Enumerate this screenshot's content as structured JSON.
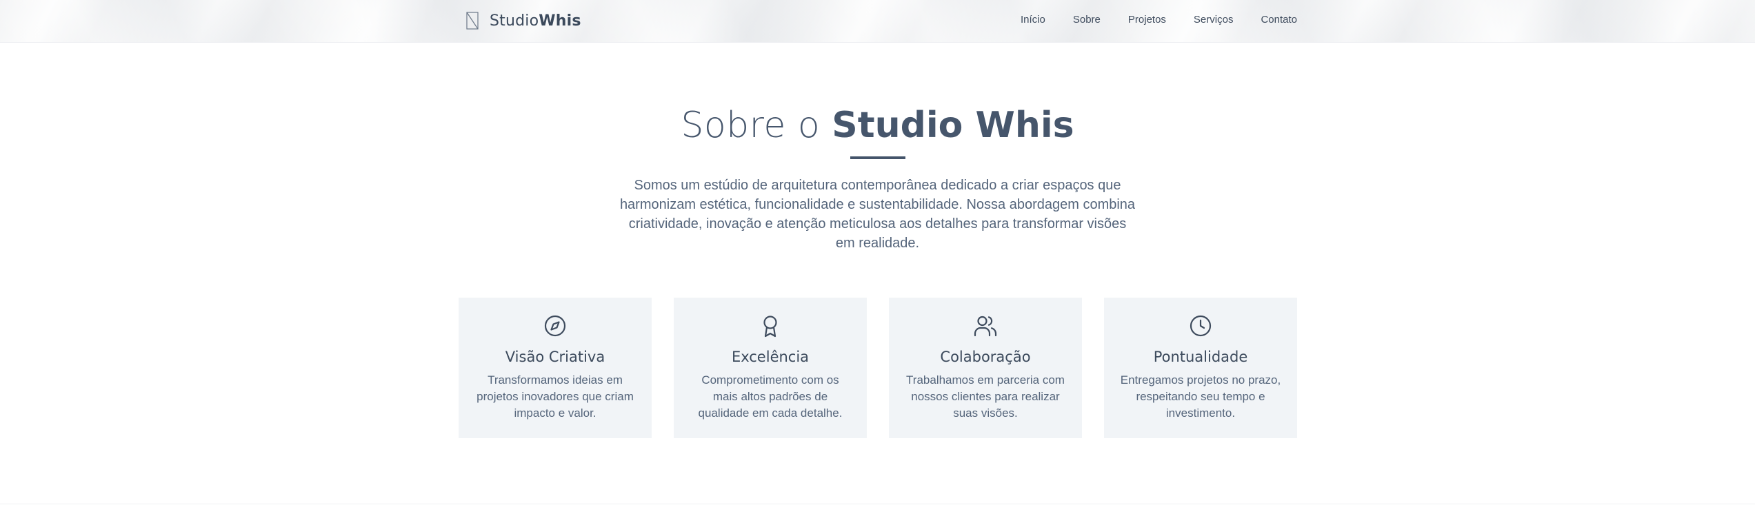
{
  "header": {
    "logo": {
      "icon": "building-logo-icon",
      "name_light": "Studio",
      "name_bold": "Whis"
    },
    "nav": [
      {
        "label": "Início"
      },
      {
        "label": "Sobre"
      },
      {
        "label": "Projetos"
      },
      {
        "label": "Serviços"
      },
      {
        "label": "Contato"
      }
    ]
  },
  "about": {
    "title_light": "Sobre o ",
    "title_bold": "Studio Whis",
    "intro": "Somos um estúdio de arquitetura contemporânea dedicado a criar espaços que harmonizam estética, funcionalidade e sustentabilidade. Nossa abordagem combina criatividade, inovação e atenção meticulosa aos detalhes para transformar visões em realidade.",
    "cards": [
      {
        "icon": "compass-icon",
        "title": "Visão Criativa",
        "description": "Transformamos ideias em projetos inovadores que criam impacto e valor."
      },
      {
        "icon": "award-icon",
        "title": "Excelência",
        "description": "Comprometimento com os mais altos padrões de qualidade em cada detalhe."
      },
      {
        "icon": "users-icon",
        "title": "Colaboração",
        "description": "Trabalhamos em parceria com nossos clientes para realizar suas visões."
      },
      {
        "icon": "clock-icon",
        "title": "Pontualidade",
        "description": "Entregamos projetos no prazo, respeitando seu tempo e investimento."
      }
    ]
  },
  "colors": {
    "text_primary": "#44546a",
    "card_background": "#f1f4f7",
    "accent_rule": "#44546a"
  }
}
